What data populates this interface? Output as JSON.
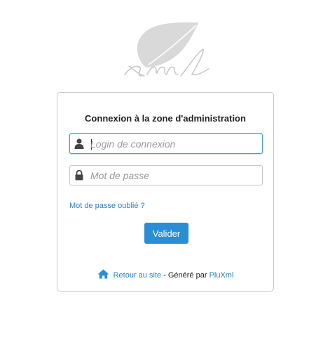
{
  "logo": {
    "icon": "leaf-icon",
    "text": "xml"
  },
  "login": {
    "title": "Connexion à la zone d'administration",
    "username": {
      "icon": "user-icon",
      "placeholder": "Login de connexion",
      "value": ""
    },
    "password": {
      "icon": "lock-icon",
      "placeholder": "Mot de passe",
      "value": ""
    },
    "forgot_link": "Mot de passe oublié ?",
    "submit_label": "Valider"
  },
  "footer": {
    "home_icon": "home-icon",
    "back_link": "Retour au site",
    "separator": " - Généré par ",
    "brand_link": "PluXml"
  },
  "colors": {
    "accent": "#2a8ed6",
    "link": "#2a7fc0",
    "focus_border": "#4c9bcf"
  }
}
